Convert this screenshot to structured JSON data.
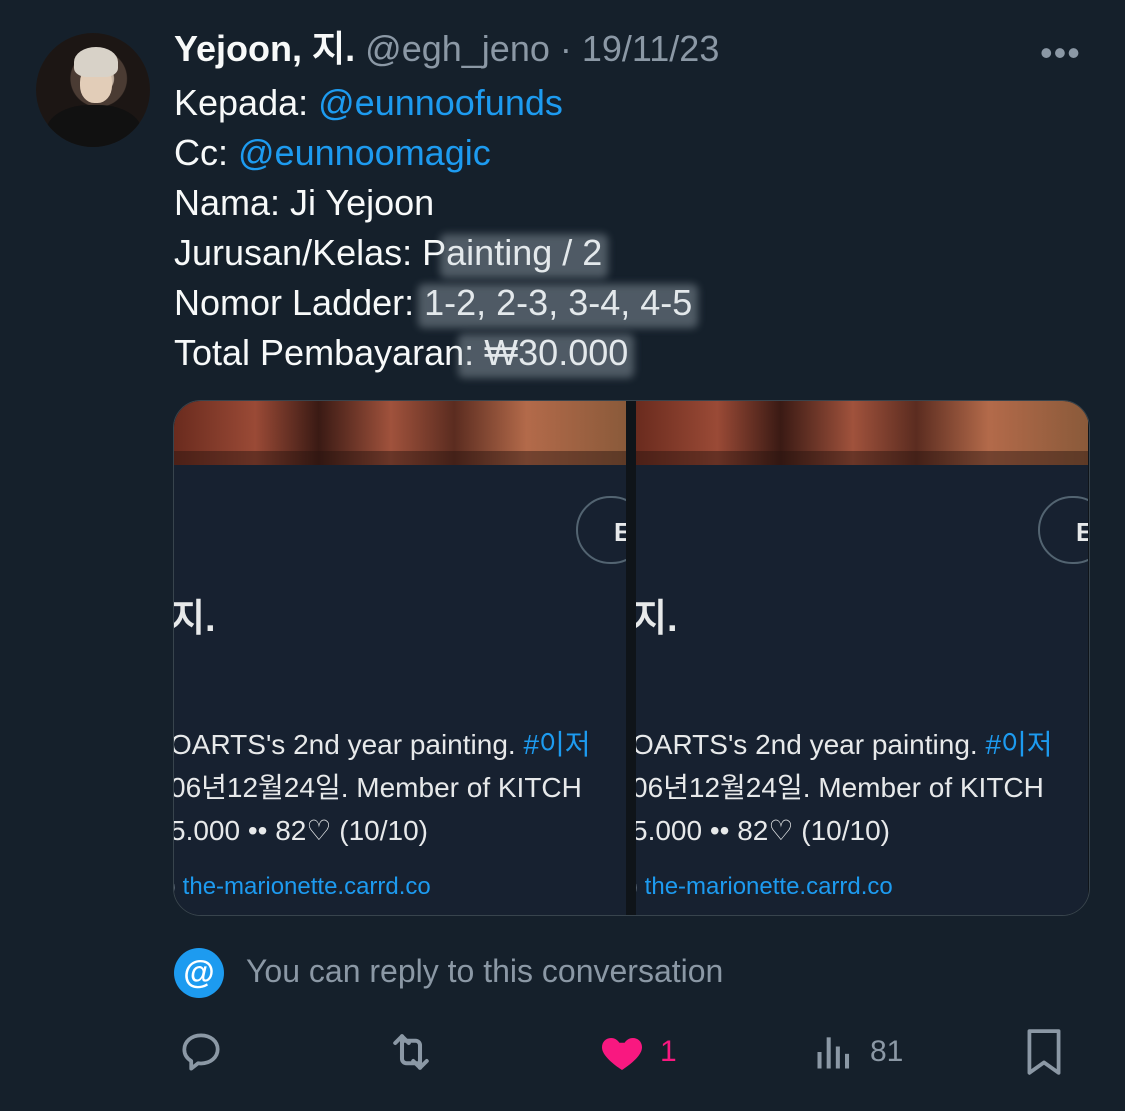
{
  "tweet": {
    "display_name": "Yejoon, 지.",
    "handle": "@egh_jeno",
    "separator": " · ",
    "date": "19/11/23",
    "more_icon": "more-dots-icon",
    "lines": {
      "to_label": "Kepada: ",
      "to_mention": "@eunnoofunds",
      "cc_label": "Cc: ",
      "cc_mention": "@eunnoomagic",
      "name_line": "Nama: Ji Yejoon",
      "major_prefix": "Jurusan/Kelas: P",
      "major_blurred": "ainting / 2",
      "ladder_label": "Nomor Ladder: ",
      "ladder_value": "1-2, 2-3, 3-4, 4-5",
      "total_label": "Total Pembayaran",
      "total_blurred": " : ₩30.000"
    }
  },
  "media": {
    "panels": [
      {
        "follow_label": "E",
        "name": "지.",
        "bio_line1_text": "OARTS's 2nd year painting. ",
        "bio_line1_tag": "#이저",
        "bio_line2": "06년12월24일. Member of KITCH",
        "bio_line3": "5.000 •• 82♡ (10/10)",
        "link_icon": ")",
        "link": "the-marionette.carrd.co"
      },
      {
        "follow_label": "E",
        "name": "지.",
        "bio_line1_text": "OARTS's 2nd year painting. ",
        "bio_line1_tag": "#이저",
        "bio_line2": "06년12월24일. Member of KITCH",
        "bio_line3": "5.000 •• 82♡ (10/10)",
        "link_icon": ")",
        "link": "the-marionette.carrd.co"
      }
    ]
  },
  "reply_notice": {
    "icon": "at-icon",
    "at_symbol": "@",
    "text": "You can reply to this conversation"
  },
  "actions": {
    "likes": "1",
    "views": "81"
  },
  "colors": {
    "background": "#15202b",
    "accent": "#1d9bf0",
    "like": "#f91880",
    "muted": "#8b98a5"
  }
}
